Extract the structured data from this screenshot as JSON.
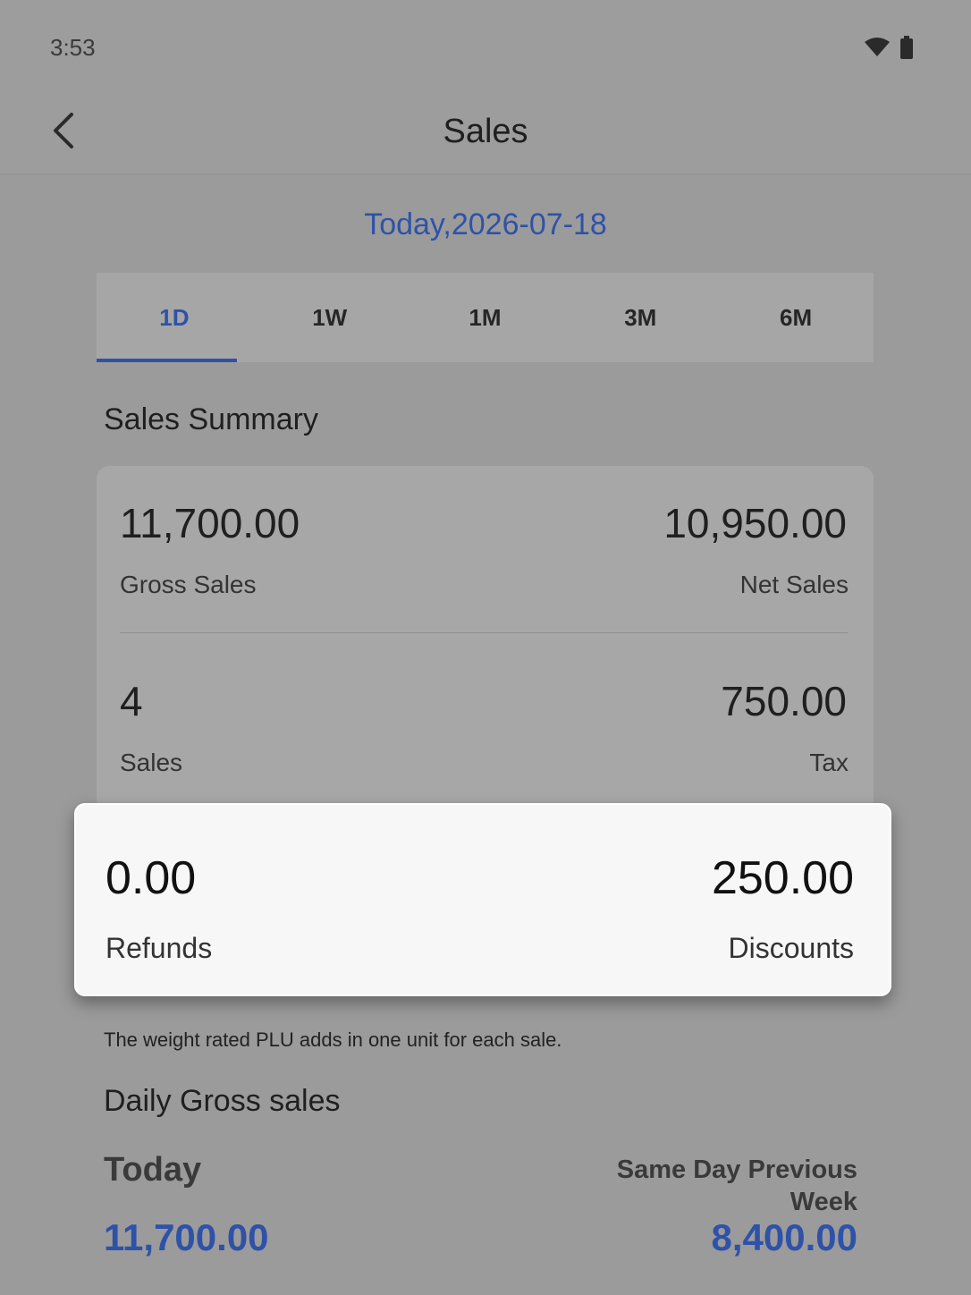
{
  "status_bar": {
    "time": "3:53",
    "icons": [
      "wifi-icon",
      "battery-icon"
    ]
  },
  "app_bar": {
    "back_icon": "chevron-left-icon",
    "title": "Sales"
  },
  "date_label": "Today,2026-07-18",
  "tabs": [
    {
      "label": "1D",
      "active": true
    },
    {
      "label": "1W",
      "active": false
    },
    {
      "label": "1M",
      "active": false
    },
    {
      "label": "3M",
      "active": false
    },
    {
      "label": "6M",
      "active": false
    }
  ],
  "sales_summary": {
    "title": "Sales Summary",
    "gross_sales": {
      "value": "11,700.00",
      "label": "Gross Sales"
    },
    "net_sales": {
      "value": "10,950.00",
      "label": "Net Sales"
    },
    "sales": {
      "value": "4",
      "label": "Sales"
    },
    "tax": {
      "value": "750.00",
      "label": "Tax"
    },
    "refunds": {
      "value": "0.00",
      "label": "Refunds"
    },
    "discounts": {
      "value": "250.00",
      "label": "Discounts"
    }
  },
  "note": "The weight rated PLU adds in one unit for each sale.",
  "daily_gross": {
    "title": "Daily Gross sales",
    "today_label": "Today",
    "today_value": "11,700.00",
    "previous_label_line1": "Same Day Previous",
    "previous_label_line2": "Week",
    "previous_value": "8,400.00"
  },
  "colors": {
    "accent": "#2f52a8",
    "background": "#9b9b9b",
    "highlight_card": "#f7f7f7"
  }
}
